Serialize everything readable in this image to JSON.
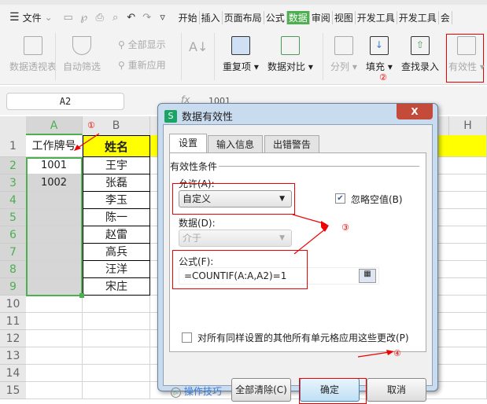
{
  "menu": {
    "file": "文件",
    "tabs": [
      "开始",
      "插入",
      "页面布局",
      "公式",
      "数据",
      "审阅",
      "视图",
      "开发工具",
      "开发工具",
      "会"
    ],
    "active": "数据"
  },
  "ribbon": {
    "pivot": "数据透视表",
    "autofilter": "自动筛选",
    "show_all": "全部显示",
    "reapply": "重新应用",
    "duplicates": "重复项",
    "compare": "数据对比",
    "split": "分列",
    "fill": "填充",
    "lookup": "查找录入",
    "validation": "有效性"
  },
  "formula_bar": {
    "name_box": "A2",
    "fx": "fx",
    "value": "1001"
  },
  "sheet": {
    "columns": [
      "A",
      "B",
      "H"
    ],
    "rows": [
      "1",
      "2",
      "3",
      "4",
      "5",
      "6",
      "7",
      "8",
      "9",
      "10",
      "11",
      "12",
      "13",
      "14",
      "15"
    ],
    "A": [
      "工作牌号",
      "1001",
      "1002",
      "",
      "",
      "",
      "",
      "",
      ""
    ],
    "B": [
      "姓名",
      "王宇",
      "张磊",
      "李玉",
      "陈一",
      "赵雷",
      "高兵",
      "汪洋",
      "宋庄"
    ]
  },
  "annotations": [
    "①",
    "②",
    "③",
    "④"
  ],
  "dialog": {
    "title": "数据有效性",
    "icon": "S",
    "close": "X",
    "tabs": [
      "设置",
      "输入信息",
      "出错警告"
    ],
    "group": "有效性条件",
    "allow_label": "允许(A):",
    "allow_value": "自定义",
    "ignore_blank": "忽略空值(B)",
    "ignore_blank_checked": true,
    "data_label": "数据(D):",
    "data_value": "介于",
    "formula_label": "公式(F):",
    "formula_value": "=COUNTIF(A:A,A2)=1",
    "apply_all": "对所有同样设置的其他所有单元格应用这些更改(P)",
    "tips": "操作技巧",
    "clear_all": "全部清除(C)",
    "ok": "确定",
    "cancel": "取消"
  },
  "colors": {
    "accent": "#4caf50",
    "highlight": "#ffff00",
    "annotation": "#e00000"
  }
}
